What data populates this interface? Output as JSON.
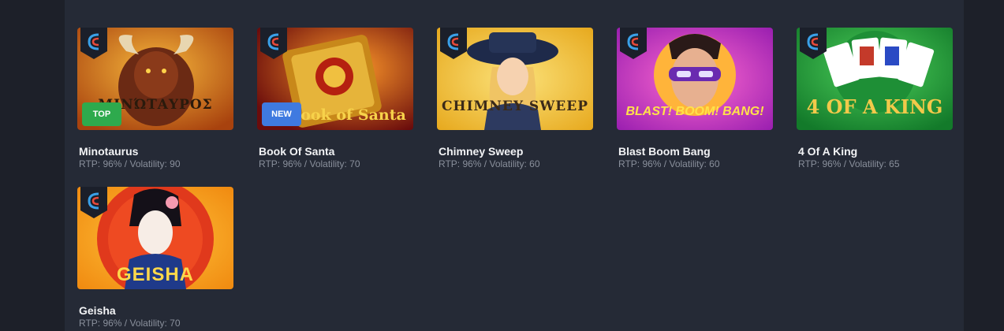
{
  "games": [
    {
      "name": "Minotaurus",
      "meta": "RTP: 96% / Volatility: 90",
      "badge": "TOP",
      "art_text": "ΜΙΝΏΤΑΥΡΟΣ"
    },
    {
      "name": "Book Of Santa",
      "meta": "RTP: 96% / Volatility: 70",
      "badge": "NEW",
      "art_text": "Book of Santa"
    },
    {
      "name": "Chimney Sweep",
      "meta": "RTP: 96% / Volatility: 60",
      "badge": "",
      "art_text": "CHIMNEY SWEEP"
    },
    {
      "name": "Blast Boom Bang",
      "meta": "RTP: 96% / Volatility: 60",
      "badge": "",
      "art_text": "BLAST! BOOM! BANG!"
    },
    {
      "name": "4 Of A King",
      "meta": "RTP: 96% / Volatility: 65",
      "badge": "",
      "art_text": "4 OF A KING"
    },
    {
      "name": "Geisha",
      "meta": "RTP: 96% / Volatility: 70",
      "badge": "",
      "art_text": "GEISHA"
    }
  ],
  "colors": {
    "page_bg": "#1d2029",
    "panel_bg": "#252a36",
    "badge_top": "#2eaa4d",
    "badge_new": "#3f7ae0"
  }
}
